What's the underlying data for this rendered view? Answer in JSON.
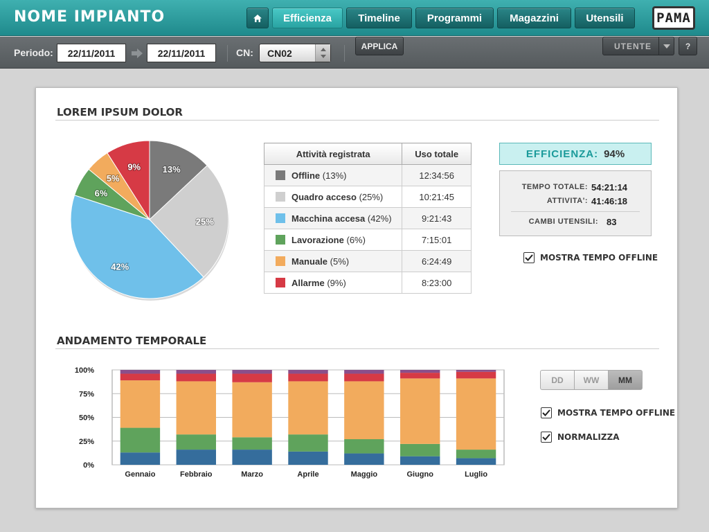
{
  "header": {
    "title": "NOME IMPIANTO",
    "nav": [
      {
        "label": "Efficienza",
        "active": true
      },
      {
        "label": "Timeline",
        "active": false
      },
      {
        "label": "Programmi",
        "active": false
      },
      {
        "label": "Magazzini",
        "active": false
      },
      {
        "label": "Utensili",
        "active": false
      }
    ],
    "logo": "PAMA"
  },
  "toolbar": {
    "period_label": "Periodo:",
    "date_from": "22/11/2011",
    "date_to": "22/11/2011",
    "cn_label": "CN:",
    "cn_value": "CN02",
    "apply_label": "APPLICA",
    "user_label": "UTENTE",
    "help_label": "?"
  },
  "section1": {
    "title": "LOREM IPSUM DOLOR",
    "table": {
      "col_activity": "Attività registrata",
      "col_usage": "Uso totale",
      "rows": [
        {
          "name": "Offline",
          "pct": "(13%)",
          "time": "12:34:56",
          "color": "#7a7a7a"
        },
        {
          "name": "Quadro acceso",
          "pct": "(25%)",
          "time": "10:21:45",
          "color": "#cfcfcf"
        },
        {
          "name": "Macchina accesa",
          "pct": "(42%)",
          "time": "9:21:43",
          "color": "#6fc0ea"
        },
        {
          "name": "Lavorazione",
          "pct": "(6%)",
          "time": "7:15:01",
          "color": "#5fa35c"
        },
        {
          "name": "Manuale",
          "pct": "(5%)",
          "time": "6:24:49",
          "color": "#f2ab5d"
        },
        {
          "name": "Allarme",
          "pct": "(9%)",
          "time": "8:23:00",
          "color": "#d63a45"
        }
      ]
    },
    "efficiency_label": "EFFICIENZA:",
    "efficiency_value": "94%",
    "stats": {
      "total_time_label": "TEMPO TOTALE:",
      "total_time": "54:21:14",
      "activity_label": "ATTIVITA':",
      "activity": "41:46:18",
      "tool_changes_label": "CAMBI UTENSILI:",
      "tool_changes": "83"
    },
    "show_offline_label": "MOSTRA TEMPO OFFLINE"
  },
  "section2": {
    "title": "ANDAMENTO TEMPORALE",
    "segments": [
      {
        "label": "DD",
        "active": false
      },
      {
        "label": "WW",
        "active": false
      },
      {
        "label": "MM",
        "active": true
      }
    ],
    "show_offline_label": "MOSTRA TEMPO OFFLINE",
    "normalize_label": "NORMALIZZA"
  },
  "chart_data": [
    {
      "type": "pie",
      "categories": [
        "Offline",
        "Quadro acceso",
        "Macchina accesa",
        "Lavorazione",
        "Manuale",
        "Allarme"
      ],
      "values": [
        13,
        25,
        42,
        6,
        5,
        9
      ],
      "labels": [
        "13%",
        "25%",
        "42%",
        "6%",
        "5%",
        "9%"
      ],
      "colors": [
        "#7a7a7a",
        "#cfcfcf",
        "#6fc0ea",
        "#5fa35c",
        "#f2ab5d",
        "#d63a45"
      ]
    },
    {
      "type": "bar",
      "stacked": true,
      "categories": [
        "Gennaio",
        "Febbraio",
        "Marzo",
        "Aprile",
        "Maggio",
        "Giugno",
        "Luglio"
      ],
      "yticks": [
        "0%",
        "25%",
        "50%",
        "75%",
        "100%"
      ],
      "ylim": [
        0,
        100
      ],
      "grid": true,
      "series": [
        {
          "color": "#356d9c",
          "values": [
            13,
            16,
            16,
            14,
            12,
            9,
            7
          ]
        },
        {
          "color": "#5fa35c",
          "values": [
            26,
            16,
            13,
            18,
            15,
            13,
            9
          ]
        },
        {
          "color": "#f2ab5d",
          "values": [
            50,
            56,
            58,
            56,
            61,
            69,
            75
          ]
        },
        {
          "color": "#d63a45",
          "values": [
            7,
            8,
            9,
            8,
            8,
            6,
            7
          ]
        },
        {
          "color": "#8a4f8a",
          "values": [
            4,
            4,
            4,
            4,
            4,
            3,
            2
          ]
        }
      ]
    }
  ]
}
